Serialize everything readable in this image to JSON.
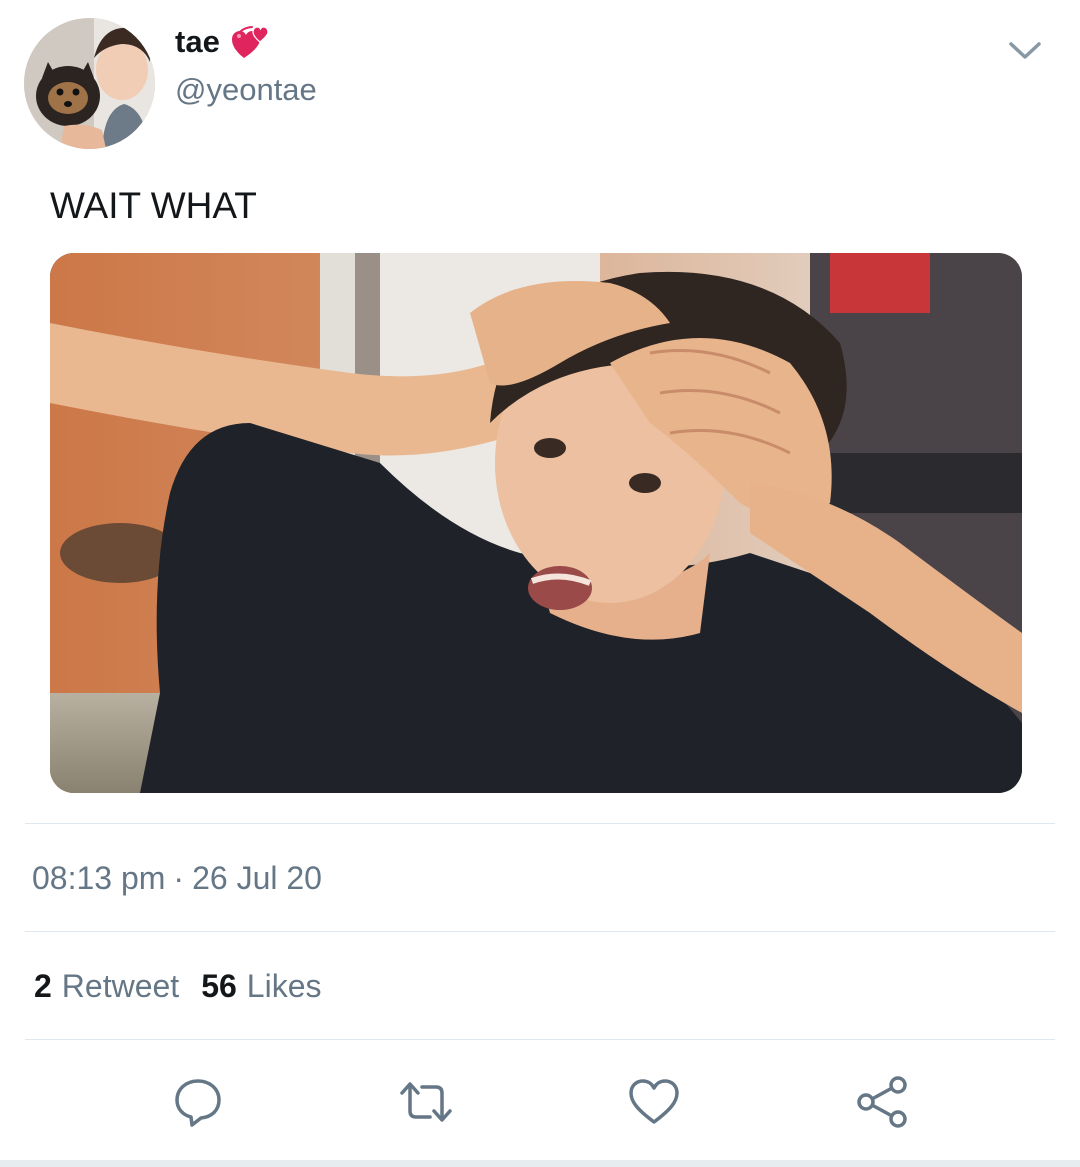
{
  "tweet": {
    "author": {
      "display_name": "tae",
      "name_emoji": "revolving-hearts",
      "handle": "@yeontae",
      "avatar_icon": "avatar-photo"
    },
    "menu_icon": "chevron-down-icon",
    "text": "WAIT WHAT",
    "media": {
      "kind": "photo"
    },
    "timestamp": {
      "time": "08:13 pm",
      "separator": "·",
      "date": "26 Jul 20"
    },
    "stats": {
      "retweets": {
        "count": "2",
        "label": "Retweet"
      },
      "likes": {
        "count": "56",
        "label": "Likes"
      }
    },
    "actions": [
      {
        "name": "reply",
        "icon": "reply-icon"
      },
      {
        "name": "retweet",
        "icon": "retweet-icon"
      },
      {
        "name": "like",
        "icon": "heart-icon"
      },
      {
        "name": "share",
        "icon": "share-icon"
      }
    ],
    "colors": {
      "text": "#14171a",
      "secondary": "#657786",
      "divider": "#e1e8ed",
      "heart_emoji": "#e0245e"
    }
  }
}
